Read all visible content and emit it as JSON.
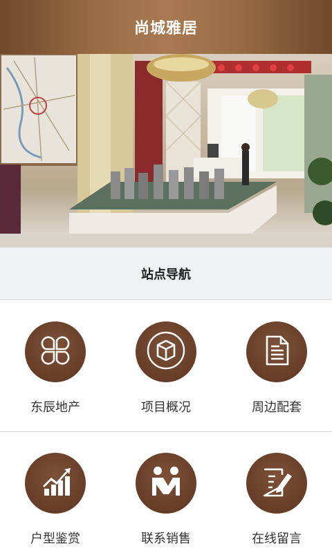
{
  "header": {
    "title": "尚城雅居"
  },
  "banner": {
    "image": "sales-office-interior-photo",
    "slide_count": 5,
    "active_slide": 1
  },
  "section": {
    "title": "站点导航"
  },
  "nav": {
    "items": [
      {
        "label": "东辰地产",
        "icon": "clover-icon"
      },
      {
        "label": "项目概况",
        "icon": "cube-icon"
      },
      {
        "label": "周边配套",
        "icon": "document-icon"
      },
      {
        "label": "户型鉴赏",
        "icon": "growth-chart-icon"
      },
      {
        "label": "联系销售",
        "icon": "people-icon"
      },
      {
        "label": "在线留言",
        "icon": "edit-note-icon"
      }
    ],
    "icon_bg_color": "#6a402a"
  },
  "colors": {
    "header": "#9b6d45",
    "section_bg": "#eff1f4"
  }
}
